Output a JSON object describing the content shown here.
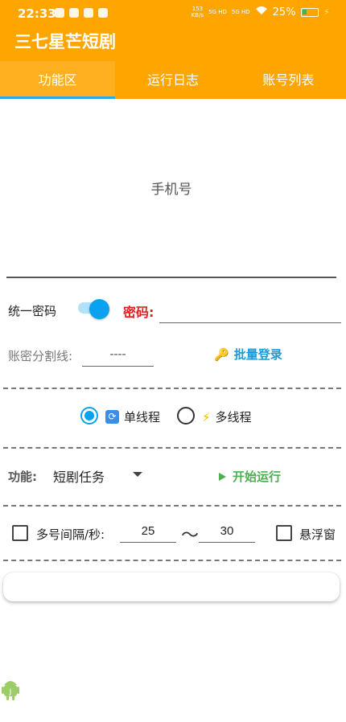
{
  "status": {
    "time": "22:33",
    "speed_value": "153",
    "speed_unit": "KB/s",
    "sig1": "5G HD",
    "sig2": "5G HD",
    "battery": "25%"
  },
  "app": {
    "title": "三七星芒短剧"
  },
  "tabs": [
    {
      "label": "功能区",
      "active": true
    },
    {
      "label": "运行日志",
      "active": false
    },
    {
      "label": "账号列表",
      "active": false
    }
  ],
  "login": {
    "phone_label": "手机号",
    "unify_password_label": "统一密码",
    "unify_password_on": true,
    "password_label": "密码:",
    "password_value": "",
    "split_label": "账密分割线:",
    "split_value": "----",
    "batch_login_label": "批量登录",
    "batch_login_icon": "key-icon"
  },
  "threads": {
    "single_label": "单线程",
    "multi_label": "多线程",
    "selected": "single"
  },
  "function": {
    "label": "功能:",
    "selected": "短剧任务",
    "start_label": "开始运行"
  },
  "interval": {
    "label": "多号间隔/秒:",
    "min": "25",
    "max": "30",
    "separator": "～",
    "float_window_label": "悬浮窗"
  },
  "colors": {
    "primary": "#ffa500",
    "accent": "#0aa2f0",
    "danger": "#e0201f",
    "success": "#4caf50",
    "link": "#1a9bd8"
  }
}
